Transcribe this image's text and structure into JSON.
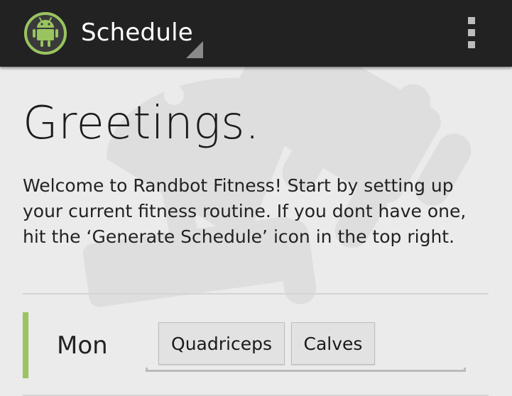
{
  "actionbar": {
    "title": "Schedule",
    "app_icon": "android-robot-icon",
    "overflow_icon": "overflow-menu-icon",
    "spinner_indicator_icon": "dropdown-corner-icon"
  },
  "main": {
    "greeting": "Greetings.",
    "welcome": "Welcome to Randbot Fitness! Start by setting up your current fitness routine. If you dont have one, hit the ‘Generate Schedule’ icon in the top right."
  },
  "schedule": {
    "days": [
      {
        "label": "Mon",
        "muscles": [
          "Quadriceps",
          "Calves"
        ]
      }
    ]
  },
  "colors": {
    "actionbar": "#222222",
    "accent_green": "#99c45f",
    "background": "#ebebeb"
  }
}
